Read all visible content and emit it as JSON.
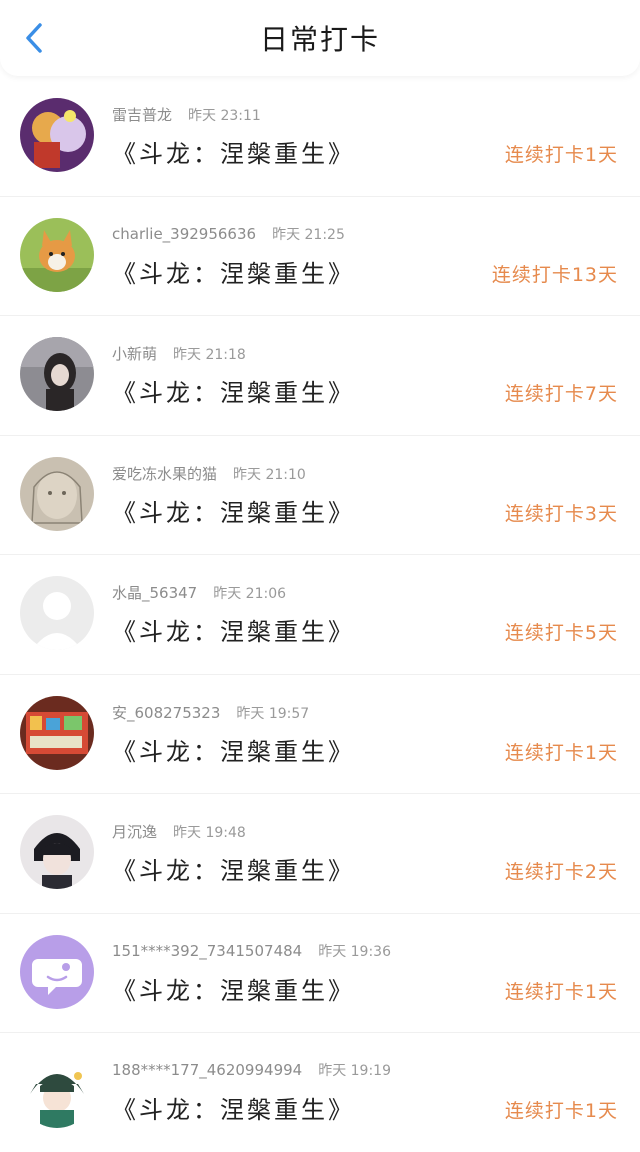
{
  "header": {
    "title": "日常打卡",
    "back_icon": "chevron-left-icon",
    "accent": "#3a8ee6"
  },
  "colors": {
    "streak": "#e68a4d"
  },
  "items": [
    {
      "name": "雷吉普龙",
      "time": "昨天 23:11",
      "book": "《斗龙：涅槃重生》",
      "streak": "连续打卡1天",
      "avatar": "anime-avatar"
    },
    {
      "name": "charlie_392956636",
      "time": "昨天 21:25",
      "book": "《斗龙：涅槃重生》",
      "streak": "连续打卡13天",
      "avatar": "corgi-avatar"
    },
    {
      "name": "小新萌",
      "time": "昨天 21:18",
      "book": "《斗龙：涅槃重生》",
      "streak": "连续打卡7天",
      "avatar": "girl-avatar"
    },
    {
      "name": "爱吃冻水果的猫",
      "time": "昨天 21:10",
      "book": "《斗龙：涅槃重生》",
      "streak": "连续打卡3天",
      "avatar": "sketch-avatar"
    },
    {
      "name": "水晶_56347",
      "time": "昨天 21:06",
      "book": "《斗龙：涅槃重生》",
      "streak": "连续打卡5天",
      "avatar": "default-avatar"
    },
    {
      "name": "安_608275323",
      "time": "昨天 19:57",
      "book": "《斗龙：涅槃重生》",
      "streak": "连续打卡1天",
      "avatar": "shelf-avatar"
    },
    {
      "name": "月沉逸",
      "time": "昨天 19:48",
      "book": "《斗龙：涅槃重生》",
      "streak": "连续打卡2天",
      "avatar": "boy-avatar"
    },
    {
      "name": "151****392_7341507484",
      "time": "昨天 19:36",
      "book": "《斗龙：涅槃重生》",
      "streak": "连续打卡1天",
      "avatar": "chat-bubble-avatar"
    },
    {
      "name": "188****177_4620994994",
      "time": "昨天 19:19",
      "book": "《斗龙：涅槃重生》",
      "streak": "连续打卡1天",
      "avatar": "anime-boy-avatar"
    }
  ]
}
